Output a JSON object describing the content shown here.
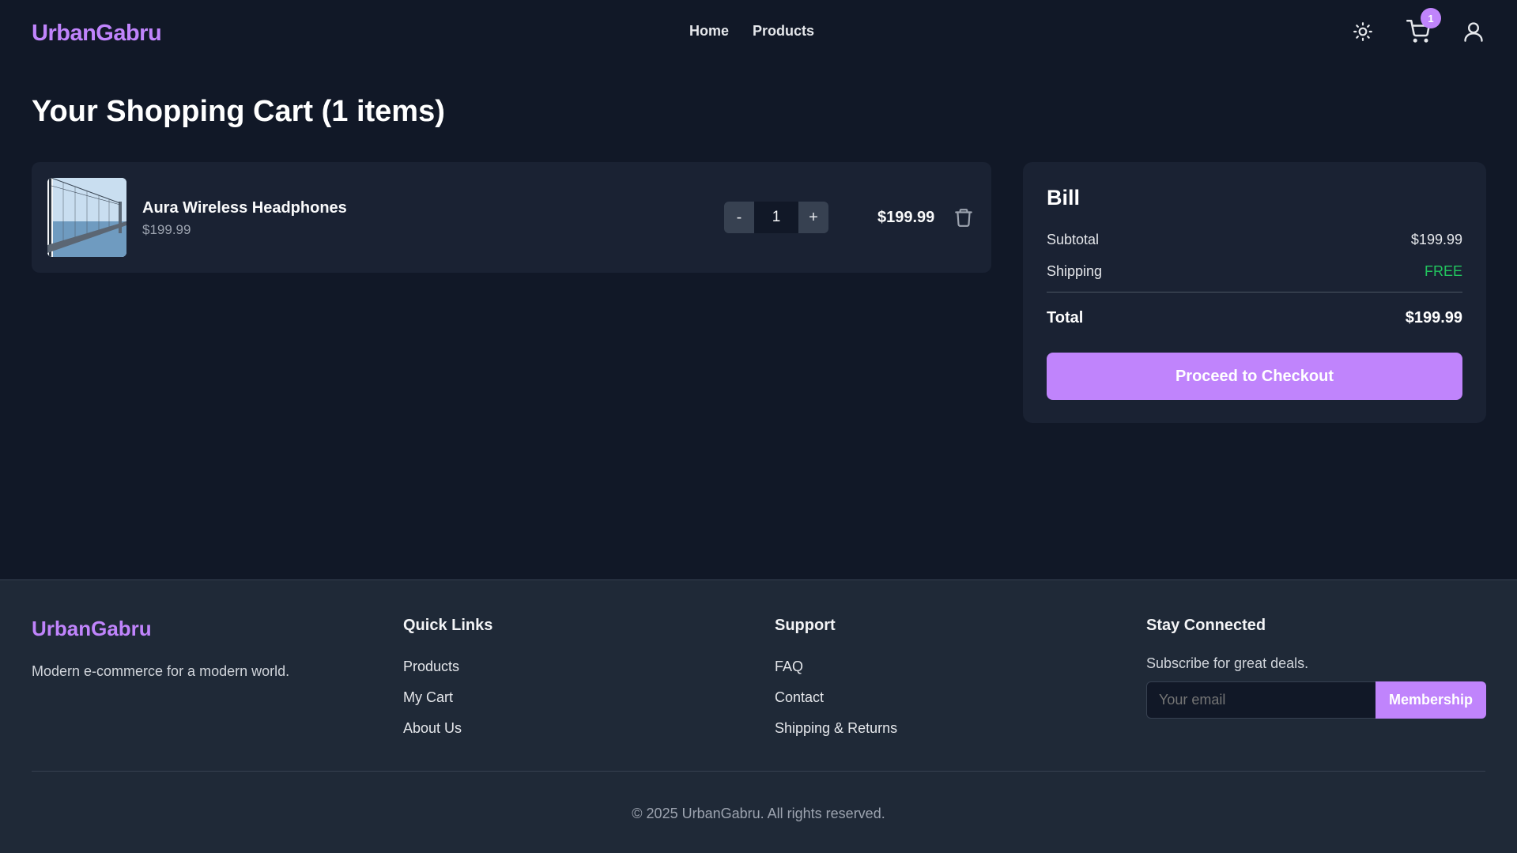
{
  "brand": {
    "name": "UrbanGabru",
    "color": "#c084fc"
  },
  "nav": {
    "items": [
      "Home",
      "Products"
    ]
  },
  "header_icons": {
    "theme": "sun-icon",
    "cart": "cart-icon",
    "user": "user-icon",
    "cart_count": "1"
  },
  "page": {
    "title": "Your Shopping Cart (1 items)"
  },
  "cart": {
    "items": [
      {
        "name": "Aura Wireless Headphones",
        "price": "$199.99",
        "quantity": "1",
        "line_total": "$199.99",
        "decrement_label": "-",
        "increment_label": "+"
      }
    ]
  },
  "bill": {
    "title": "Bill",
    "subtotal_label": "Subtotal",
    "subtotal_value": "$199.99",
    "shipping_label": "Shipping",
    "shipping_value": "FREE",
    "total_label": "Total",
    "total_value": "$199.99",
    "checkout_label": "Proceed to Checkout"
  },
  "footer": {
    "brand": "UrbanGabru",
    "tagline": "Modern e-commerce for a modern world.",
    "quick_links": {
      "heading": "Quick Links",
      "items": [
        "Products",
        "My Cart",
        "About Us"
      ]
    },
    "support": {
      "heading": "Support",
      "items": [
        "FAQ",
        "Contact",
        "Shipping & Returns"
      ]
    },
    "connect": {
      "heading": "Stay Connected",
      "subtitle": "Subscribe for great deals.",
      "email_placeholder": "Your email",
      "button_label": "Membership"
    },
    "copyright": "© 2025 UrbanGabru. All rights reserved."
  }
}
